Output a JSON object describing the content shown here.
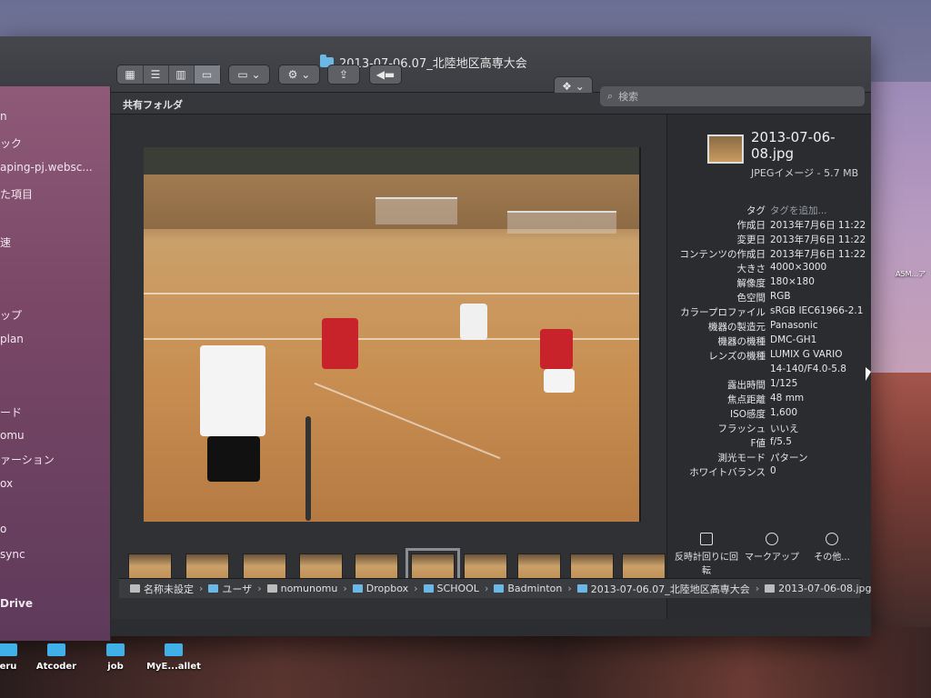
{
  "window": {
    "title": "2013-07-06.07_北陸地区高専大会",
    "shared_folder_label": "共有フォルダ"
  },
  "search": {
    "placeholder": "検索"
  },
  "sidebar": {
    "items": [
      "n",
      "ック",
      "aping-pj.websc...",
      "た項目",
      "速",
      "ップ",
      "plan",
      "ード",
      "omu",
      "ァーション",
      "ox",
      "o",
      "sync",
      "Drive"
    ]
  },
  "inspector": {
    "file_name": "2013-07-06-08.jpg",
    "file_kind": "JPEGイメージ - 5.7 MB",
    "rows": [
      {
        "key": "タグ",
        "value": "タグを追加...",
        "link": true
      },
      {
        "key": "作成日",
        "value": "2013年7月6日 11:22"
      },
      {
        "key": "変更日",
        "value": "2013年7月6日 11:22"
      },
      {
        "key": "コンテンツの作成日",
        "value": "2013年7月6日 11:22"
      },
      {
        "key": "大きさ",
        "value": "4000×3000"
      },
      {
        "key": "解像度",
        "value": "180×180"
      },
      {
        "key": "色空間",
        "value": "RGB"
      },
      {
        "key": "カラープロファイル",
        "value": "sRGB IEC61966-2.1"
      },
      {
        "key": "機器の製造元",
        "value": "Panasonic"
      },
      {
        "key": "機器の機種",
        "value": "DMC-GH1"
      },
      {
        "key": "レンズの機種",
        "value": "LUMIX G VARIO"
      },
      {
        "key": "",
        "value": "14-140/F4.0-5.8"
      },
      {
        "key": "露出時間",
        "value": "1/125"
      },
      {
        "key": "焦点距離",
        "value": "48 mm"
      },
      {
        "key": "ISO感度",
        "value": "1,600"
      },
      {
        "key": "フラッシュ",
        "value": "いいえ"
      },
      {
        "key": "F値",
        "value": "f/5.5"
      },
      {
        "key": "測光モード",
        "value": "パターン"
      },
      {
        "key": "ホワイトバランス",
        "value": "0"
      }
    ],
    "actions": {
      "rotate": "反時計回りに回転",
      "markup": "マークアップ",
      "more": "その他..."
    }
  },
  "pathbar": {
    "crumbs": [
      "名称未設定",
      "ユーザ",
      "nomunomu",
      "Dropbox",
      "SCHOOL",
      "Badminton",
      "2013-07-06.07_北陸地区高専大会",
      "2013-07-06-08.jpg"
    ]
  },
  "desktop": {
    "icons": [
      "eru",
      "Atcoder",
      "job",
      "MyE...allet"
    ],
    "right_file": "A5M...ア"
  },
  "colors": {
    "folder": "#6bb8e6",
    "window_bg": "#2b2d31"
  }
}
